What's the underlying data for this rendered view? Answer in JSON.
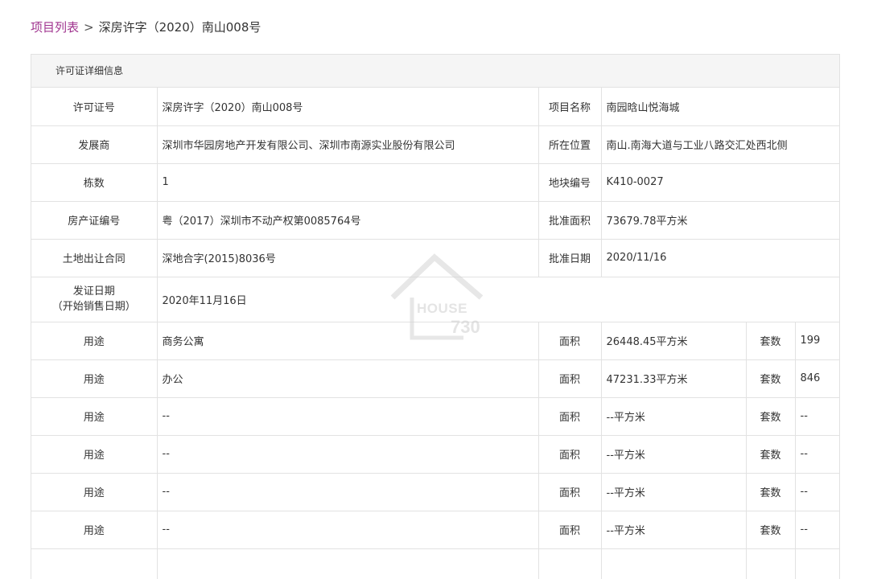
{
  "breadcrumb": {
    "link": "项目列表",
    "separator": ">",
    "current": "深房许字（2020）南山008号"
  },
  "panel": {
    "title": "许可证详细信息"
  },
  "info": {
    "license_no_label": "许可证号",
    "license_no": "深房许字（2020）南山008号",
    "project_name_label": "项目名称",
    "project_name": "南园晗山悦海城",
    "developer_label": "发展商",
    "developer": "深圳市华园房地产开发有限公司、深圳市南源实业股份有限公司",
    "location_label": "所在位置",
    "location": "南山.南海大道与工业八路交汇处西北侧",
    "buildings_label": "栋数",
    "buildings": "1",
    "plot_no_label": "地块编号",
    "plot_no": "K410-0027",
    "property_cert_label": "房产证编号",
    "property_cert": "粤（2017）深圳市不动产权第0085764号",
    "approved_area_label": "批准面积",
    "approved_area": "73679.78平方米",
    "land_contract_label": "土地出让合同",
    "land_contract": "深地合字(2015)8036号",
    "approved_date_label": "批准日期",
    "approved_date": "2020/11/16",
    "issue_date_label_line1": "发证日期",
    "issue_date_label_line2": "（开始销售日期）",
    "issue_date": "2020年11月16日"
  },
  "usage_labels": {
    "usage": "用途",
    "area": "面积",
    "units": "套数"
  },
  "usage_rows": [
    {
      "usage": "商务公寓",
      "area": "26448.45平方米",
      "units": "199"
    },
    {
      "usage": "办公",
      "area": "47231.33平方米",
      "units": "846"
    },
    {
      "usage": "--",
      "area": "--平方米",
      "units": "--"
    },
    {
      "usage": "--",
      "area": "--平方米",
      "units": "--"
    },
    {
      "usage": "--",
      "area": "--平方米",
      "units": "--"
    },
    {
      "usage": "--",
      "area": "--平方米",
      "units": "--"
    },
    {
      "usage": "",
      "area": "",
      "units": ""
    }
  ],
  "watermark": {
    "brand": "HOUSE",
    "number": "730"
  },
  "colors": {
    "link": "#a0348f",
    "header_bg": "#f5f5f5",
    "border": "#e2e2e2"
  }
}
